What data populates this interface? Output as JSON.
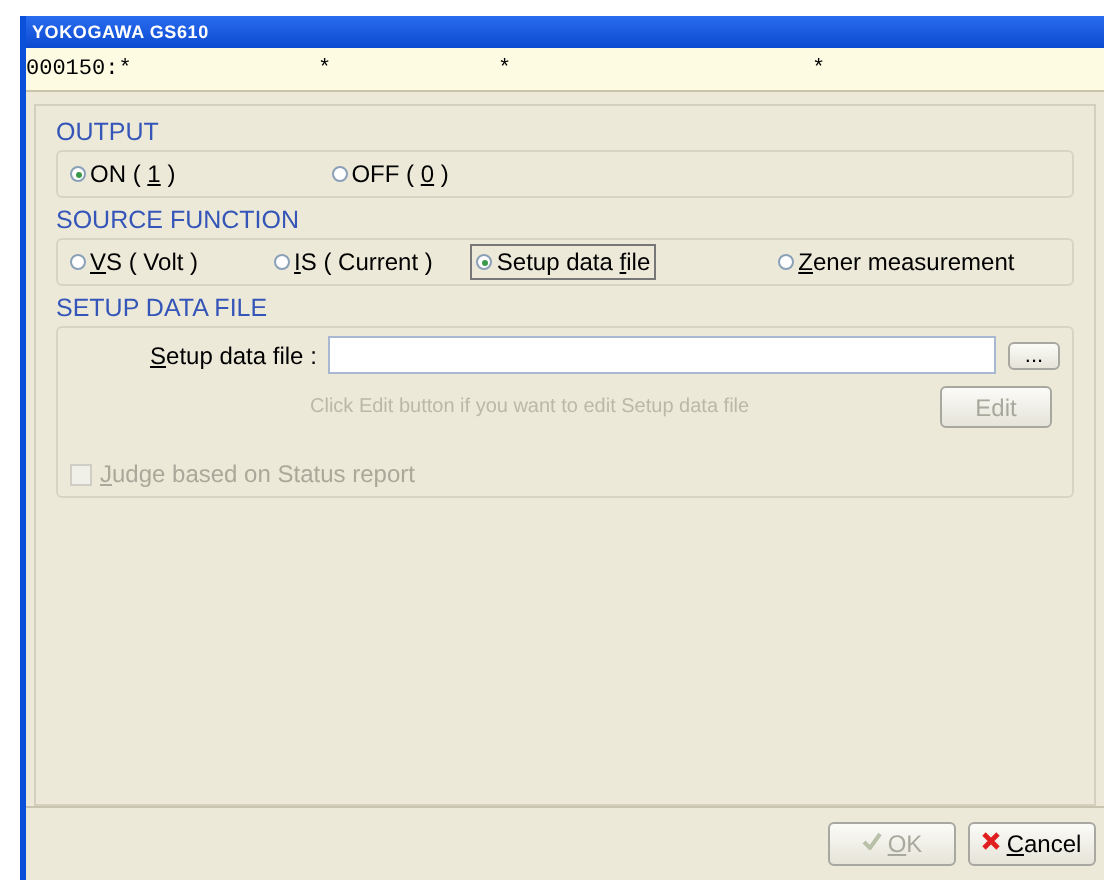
{
  "window": {
    "title": "YOKOGAWA GS610"
  },
  "status_line": [
    "000150:*",
    "*",
    "*",
    "*"
  ],
  "output": {
    "title": "OUTPUT",
    "options": [
      {
        "before": "ON ( ",
        "key": "1",
        "after": " )",
        "selected": true
      },
      {
        "before": "OFF ( ",
        "key": "0",
        "after": " )",
        "selected": false
      }
    ]
  },
  "source_function": {
    "title": "SOURCE FUNCTION",
    "options": [
      {
        "key": "V",
        "after": "S ( Volt )",
        "selected": false
      },
      {
        "key": "I",
        "after": "S ( Current )",
        "selected": false
      },
      {
        "before": "Setup data ",
        "key": "f",
        "after": "ile",
        "selected": true
      },
      {
        "key": "Z",
        "after": "ener measurement",
        "selected": false
      }
    ]
  },
  "setup_data_file": {
    "title": "SETUP DATA FILE",
    "field_label": {
      "key": "S",
      "after": "etup data file :"
    },
    "browse_button": "...",
    "hint": "Click Edit button if you want to edit Setup data file",
    "edit_button": {
      "label": "Edit",
      "disabled": true
    }
  },
  "judge_checkbox": {
    "key": "J",
    "after": "udge based on Status report",
    "checked": false,
    "disabled": true
  },
  "buttons": [
    {
      "kind": "ok",
      "key": "O",
      "after": "K",
      "disabled": true
    },
    {
      "kind": "cancel",
      "key": "C",
      "after": "ancel",
      "disabled": false
    }
  ]
}
